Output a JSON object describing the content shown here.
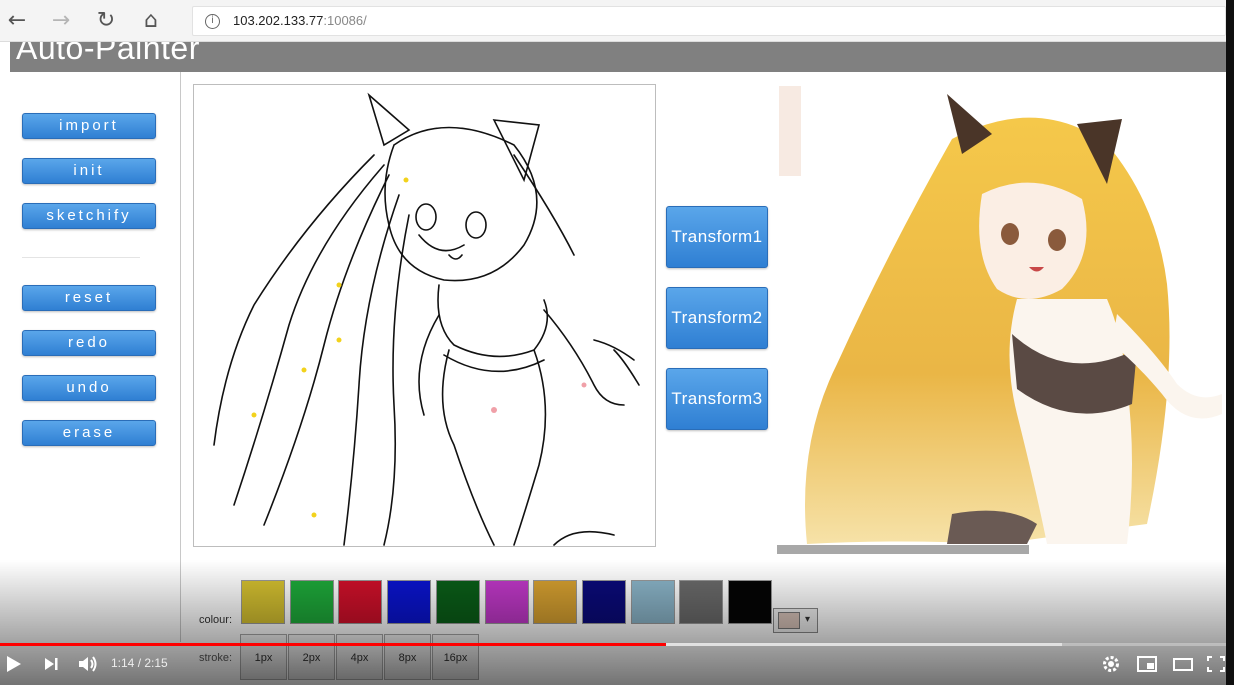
{
  "browser": {
    "url_host": "103.202.133.77",
    "url_port": ":10086/",
    "info_icon_glyph": "i",
    "back_glyph": "←",
    "forward_glyph": "→",
    "reload_glyph": "↻",
    "home_glyph": "⌂"
  },
  "app": {
    "title": "Auto-Painter"
  },
  "sidebar": {
    "buttons": [
      {
        "label": "import"
      },
      {
        "label": "init"
      },
      {
        "label": "sketchify"
      },
      {
        "label": "reset"
      },
      {
        "label": "redo"
      },
      {
        "label": "undo"
      },
      {
        "label": "erase"
      }
    ]
  },
  "transforms": [
    {
      "label": "Transform1"
    },
    {
      "label": "Transform2"
    },
    {
      "label": "Transform3"
    }
  ],
  "palette": {
    "label": "colour:",
    "colors": [
      "#d4c030",
      "#1eaa3a",
      "#d0102a",
      "#0a14d0",
      "#0a5e18",
      "#c038c8",
      "#d6a030",
      "#0a0a7a",
      "#8ab4c8",
      "#6a6a6a",
      "#050505"
    ],
    "selected_color": "#d8c3b9",
    "dropdown_glyph": "▾"
  },
  "stroke": {
    "label": "stroke:",
    "sizes": [
      "1px",
      "2px",
      "4px",
      "8px",
      "16px"
    ]
  },
  "player": {
    "time_current": "1:14",
    "time_total": "2:15",
    "time_separator": " / ",
    "progress_fraction": 0.543,
    "buffered_fraction": 0.866
  },
  "icons": {
    "play": "play-icon",
    "next": "next-icon",
    "volume": "volume-icon",
    "settings": "gear-icon",
    "miniplayer": "miniplayer-icon",
    "theater": "theater-icon",
    "fullscreen": "fullscreen-icon"
  }
}
